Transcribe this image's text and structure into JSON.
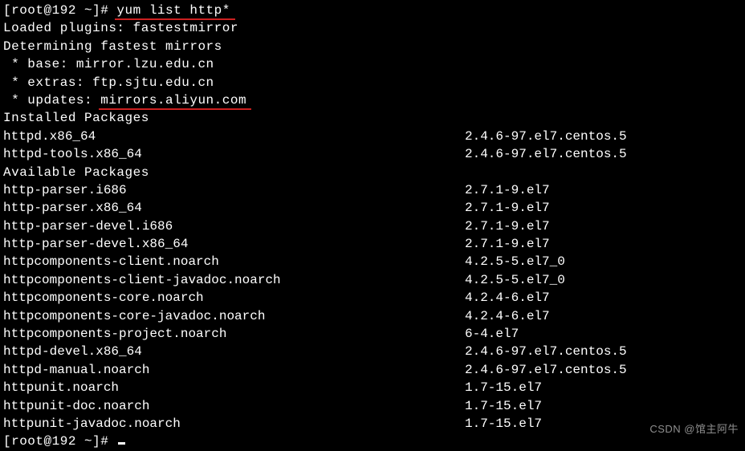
{
  "prompt1": {
    "prefix": "[root@192 ~]# ",
    "command": "yum list http*"
  },
  "output": {
    "loaded": "Loaded plugins: fastestmirror",
    "determining": "Determining fastest mirrors",
    "mirror_base": " * base: mirror.lzu.edu.cn",
    "mirror_extras": " * extras: ftp.sjtu.edu.cn",
    "mirror_updates_prefix": " * updates: ",
    "mirror_updates_host": "mirrors.aliyun.com",
    "installed_header": "Installed Packages",
    "available_header": "Available Packages"
  },
  "installed": [
    {
      "name": "httpd.x86_64",
      "version": "2.4.6-97.el7.centos.5"
    },
    {
      "name": "httpd-tools.x86_64",
      "version": "2.4.6-97.el7.centos.5"
    }
  ],
  "available": [
    {
      "name": "http-parser.i686",
      "version": "2.7.1-9.el7"
    },
    {
      "name": "http-parser.x86_64",
      "version": "2.7.1-9.el7"
    },
    {
      "name": "http-parser-devel.i686",
      "version": "2.7.1-9.el7"
    },
    {
      "name": "http-parser-devel.x86_64",
      "version": "2.7.1-9.el7"
    },
    {
      "name": "httpcomponents-client.noarch",
      "version": "4.2.5-5.el7_0"
    },
    {
      "name": "httpcomponents-client-javadoc.noarch",
      "version": "4.2.5-5.el7_0"
    },
    {
      "name": "httpcomponents-core.noarch",
      "version": "4.2.4-6.el7"
    },
    {
      "name": "httpcomponents-core-javadoc.noarch",
      "version": "4.2.4-6.el7"
    },
    {
      "name": "httpcomponents-project.noarch",
      "version": "6-4.el7"
    },
    {
      "name": "httpd-devel.x86_64",
      "version": "2.4.6-97.el7.centos.5"
    },
    {
      "name": "httpd-manual.noarch",
      "version": "2.4.6-97.el7.centos.5"
    },
    {
      "name": "httpunit.noarch",
      "version": "1.7-15.el7"
    },
    {
      "name": "httpunit-doc.noarch",
      "version": "1.7-15.el7"
    },
    {
      "name": "httpunit-javadoc.noarch",
      "version": "1.7-15.el7"
    }
  ],
  "prompt2": {
    "prefix": "[root@192 ~]# "
  },
  "watermark": "CSDN @馆主阿牛"
}
